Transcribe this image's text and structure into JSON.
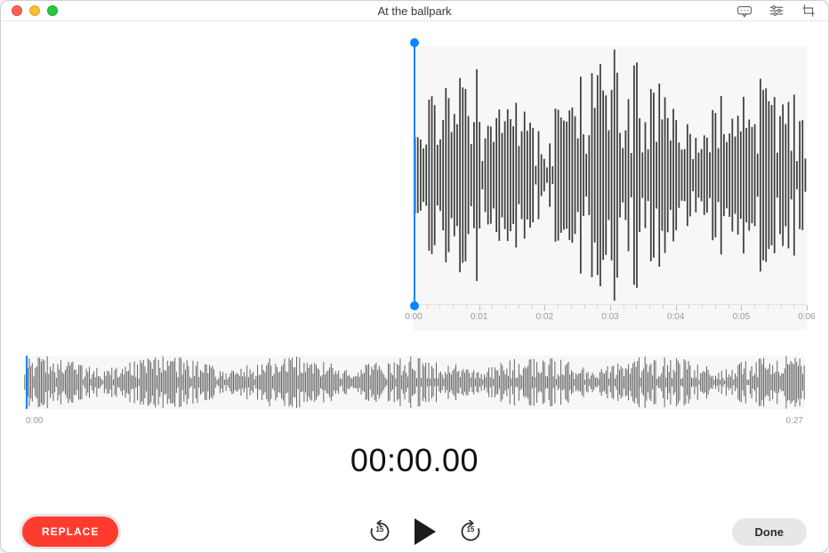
{
  "window": {
    "title": "At the ballpark"
  },
  "toolbar": {
    "transcribe_icon": "transcribe-icon",
    "settings_icon": "sliders-icon",
    "trim_icon": "crop-icon"
  },
  "detail_waveform": {
    "ruler_labels": [
      "0:00",
      "0:01",
      "0:02",
      "0:03",
      "0:04",
      "0:05",
      "0:06"
    ],
    "playhead_position": "0:00"
  },
  "overview": {
    "start_label": "0:00",
    "end_label": "0:27",
    "playhead_position": "0:00"
  },
  "timecode": "00:00.00",
  "controls": {
    "replace_label": "REPLACE",
    "skip_seconds": "15",
    "done_label": "Done"
  },
  "colors": {
    "accent": "#0a84ff",
    "record_red": "#ff3b30"
  }
}
